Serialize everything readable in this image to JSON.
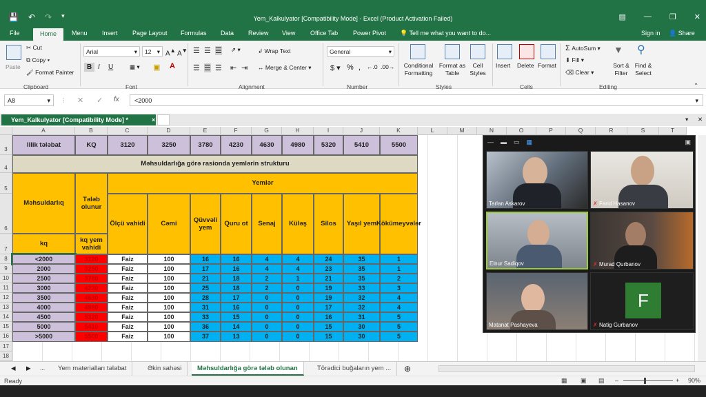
{
  "window": {
    "title": "Yem_Kalkulyator  [Compatibility Mode]  -  Excel (Product Activation Failed)",
    "sign_in": "Sign in",
    "share": "Share"
  },
  "menu": [
    {
      "label": "File"
    },
    {
      "label": "Home"
    },
    {
      "label": "Menu"
    },
    {
      "label": "Insert"
    },
    {
      "label": "Page Layout"
    },
    {
      "label": "Formulas"
    },
    {
      "label": "Data"
    },
    {
      "label": "Review"
    },
    {
      "label": "View"
    },
    {
      "label": "Office Tab"
    },
    {
      "label": "Power Pivot"
    },
    {
      "label": "Tell me what you want to do..."
    }
  ],
  "ribbon": {
    "paste": "Paste",
    "cut": "Cut",
    "copy": "Copy",
    "format_painter": "Format Painter",
    "clipboard": "Clipboard",
    "font_name": "Arial",
    "font_size": "12",
    "font": "Font",
    "wrap_text": "Wrap Text",
    "merge_center": "Merge & Center",
    "alignment": "Alignment",
    "number_format": "General",
    "number": "Number",
    "conditional_formatting": "Conditional Formatting",
    "format_as_table": "Format as Table",
    "cell_styles": "Cell Styles",
    "styles": "Styles",
    "insert": "Insert",
    "delete": "Delete",
    "format": "Format",
    "cells": "Cells",
    "autosum": "AutoSum",
    "fill": "Fill",
    "clear": "Clear",
    "sort_filter": "Sort & Filter",
    "find_select": "Find & Select",
    "editing": "Editing"
  },
  "formula_bar": {
    "name_box": "A8",
    "formula": "<2000"
  },
  "doc_tab": "Yem_Kalkulyator  [Compatibility Mode] *",
  "columns": [
    "A",
    "B",
    "C",
    "D",
    "E",
    "F",
    "G",
    "H",
    "I",
    "J",
    "K",
    "L",
    "M",
    "N",
    "O",
    "P",
    "Q",
    "R",
    "S",
    "T"
  ],
  "rows": [
    "3",
    "4",
    "5",
    "6",
    "7",
    "8",
    "9",
    "10",
    "11",
    "12",
    "13",
    "14",
    "15",
    "16",
    "17",
    "18"
  ],
  "sheet": {
    "row3": [
      "Illik tələbat",
      "KQ",
      "3120",
      "3250",
      "3780",
      "4230",
      "4630",
      "4980",
      "5320",
      "5410",
      "5500"
    ],
    "title": "Məhsuldarlığa görə rasionda yemlərin strukturu",
    "h_mahsuldarliq": "Məhsuldarlıq",
    "h_kq": "kq",
    "h_teleb": "Tələb olunur",
    "h_kq_yem": "kq yem vahidi",
    "h_yemler": "Yemlər",
    "subheaders": [
      "Ölçü vahidi",
      "Cəmi",
      "Qüvvəli yem",
      "Quru ot",
      "Senaj",
      "Küləş",
      "Silos",
      "Yaşıl yem",
      "Kökümeyvələr"
    ],
    "data": [
      [
        "<2000",
        "3120",
        "Faiz",
        "100",
        "16",
        "16",
        "4",
        "4",
        "24",
        "35",
        "1"
      ],
      [
        "2000",
        "3250",
        "Faiz",
        "100",
        "17",
        "16",
        "4",
        "4",
        "23",
        "35",
        "1"
      ],
      [
        "2500",
        "3780",
        "Faiz",
        "100",
        "21",
        "18",
        "2",
        "1",
        "21",
        "35",
        "2"
      ],
      [
        "3000",
        "4230",
        "Faiz",
        "100",
        "25",
        "18",
        "2",
        "0",
        "19",
        "33",
        "3"
      ],
      [
        "3500",
        "4630",
        "Faiz",
        "100",
        "28",
        "17",
        "0",
        "0",
        "19",
        "32",
        "4"
      ],
      [
        "4000",
        "4980",
        "Faiz",
        "100",
        "31",
        "16",
        "0",
        "0",
        "17",
        "32",
        "4"
      ],
      [
        "4500",
        "5320",
        "Faiz",
        "100",
        "33",
        "15",
        "0",
        "0",
        "16",
        "31",
        "5"
      ],
      [
        "5000",
        "5410",
        "Faiz",
        "100",
        "36",
        "14",
        "0",
        "0",
        "15",
        "30",
        "5"
      ],
      [
        ">5000",
        "5500",
        "Faiz",
        "100",
        "37",
        "13",
        "0",
        "0",
        "15",
        "30",
        "5"
      ]
    ]
  },
  "sheet_tabs": [
    "Yem materialları tələbat",
    "Əkin sahəsi",
    "Məhsuldarlığa görə tələb olunan",
    "Törədici buğaların yem ..."
  ],
  "status": {
    "ready": "Ready",
    "zoom": "90%"
  },
  "video": {
    "participants": [
      {
        "name": "Tarlan Askarov",
        "muted": false
      },
      {
        "name": "Farid Hasanov",
        "muted": true
      },
      {
        "name": "Elnur Sadiqov",
        "muted": false
      },
      {
        "name": "Murad Qurbanov",
        "muted": true
      },
      {
        "name": "Matanat Pashayeva",
        "muted": false
      },
      {
        "name": "Natig Gurbanov",
        "muted": true,
        "initial": "F"
      }
    ]
  },
  "colors": {
    "excel_green": "#217346",
    "yellow": "#ffc000",
    "blue": "#00b0f0",
    "red": "#ff0000",
    "lavender": "#ccc0da"
  }
}
